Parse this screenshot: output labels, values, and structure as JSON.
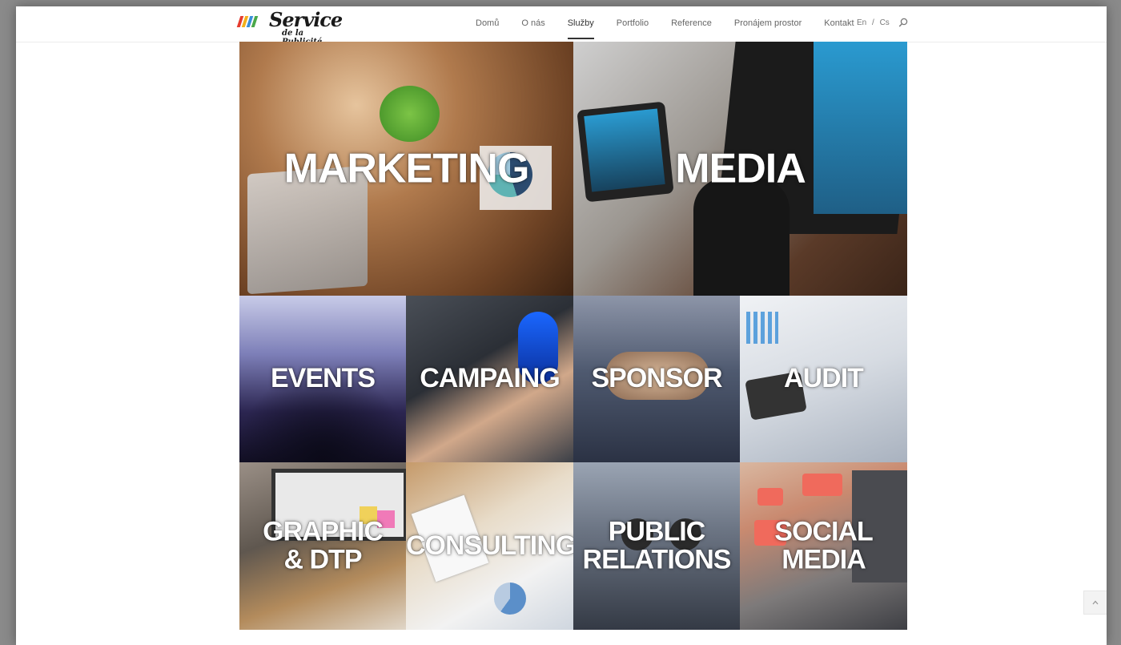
{
  "logo": {
    "title": "Service",
    "subtitle": "de la Publicité",
    "bar_colors": [
      "#e63b2e",
      "#f3b01b",
      "#3a8fd8",
      "#4aa84a"
    ]
  },
  "nav": {
    "items": [
      {
        "label": "Domů",
        "active": false
      },
      {
        "label": "O nás",
        "active": false
      },
      {
        "label": "Služby",
        "active": true
      },
      {
        "label": "Portfolio",
        "active": false
      },
      {
        "label": "Reference",
        "active": false
      },
      {
        "label": "Pronájem prostor",
        "active": false
      },
      {
        "label": "Kontakt",
        "active": false
      }
    ],
    "lang_en": "En",
    "lang_sep": "/",
    "lang_cs": "Cs",
    "search_icon": "search-icon"
  },
  "tiles": [
    {
      "id": "marketing",
      "label": "MARKETING",
      "size": "big"
    },
    {
      "id": "media",
      "label": "MEDIA",
      "size": "big"
    },
    {
      "id": "events",
      "label": "EVENTS",
      "size": "small"
    },
    {
      "id": "campaing",
      "label": "CAMPAING",
      "size": "small"
    },
    {
      "id": "sponsor",
      "label": "SPONSOR",
      "size": "small"
    },
    {
      "id": "audit",
      "label": "AUDIT",
      "size": "small"
    },
    {
      "id": "graphic",
      "label_line1": "GRAPHIC",
      "label_line2": "& DTP",
      "size": "small"
    },
    {
      "id": "consulting",
      "label": "CONSULTING",
      "size": "small"
    },
    {
      "id": "public-relations",
      "label_line1": "PUBLIC",
      "label_line2": "RELATIONS",
      "size": "small"
    },
    {
      "id": "social-media",
      "label_line1": "SOCIAL",
      "label_line2": "MEDIA",
      "size": "small"
    }
  ],
  "scroll_top_icon": "chevron-up-icon"
}
